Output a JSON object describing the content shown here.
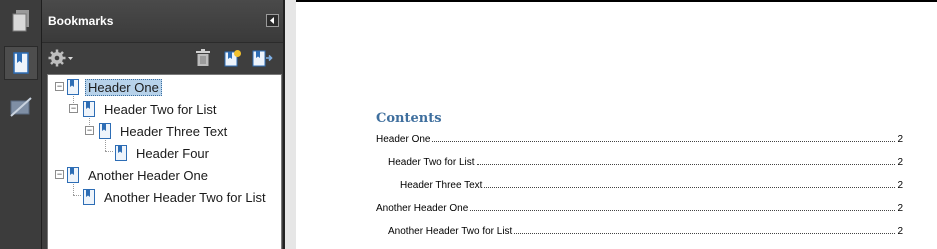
{
  "panel": {
    "title": "Bookmarks"
  },
  "toolbar": {
    "options_icon": "gear-icon",
    "delete_icon": "trash-icon",
    "new_bookmark_icon": "new-bookmark-icon",
    "expand_icon": "expand-bookmark-icon"
  },
  "bookmarks": [
    {
      "label": "Header One",
      "level": 0,
      "selected": true
    },
    {
      "label": "Header Two for List",
      "level": 1
    },
    {
      "label": "Header Three Text",
      "level": 2
    },
    {
      "label": "Header Four",
      "level": 3
    },
    {
      "label": "Another Header One",
      "level": 0
    },
    {
      "label": "Another Header Two for List",
      "level": 1
    }
  ],
  "document": {
    "toc_title": "Contents",
    "toc_entries": [
      {
        "text": "Header One",
        "page": "2",
        "level": 0
      },
      {
        "text": "Header Two for List",
        "page": "2",
        "level": 1
      },
      {
        "text": "Header Three Text",
        "page": "2",
        "level": 2
      },
      {
        "text": "Another Header One",
        "page": "2",
        "level": 0
      },
      {
        "text": "Another Header Two for List",
        "page": "2",
        "level": 1
      }
    ]
  }
}
